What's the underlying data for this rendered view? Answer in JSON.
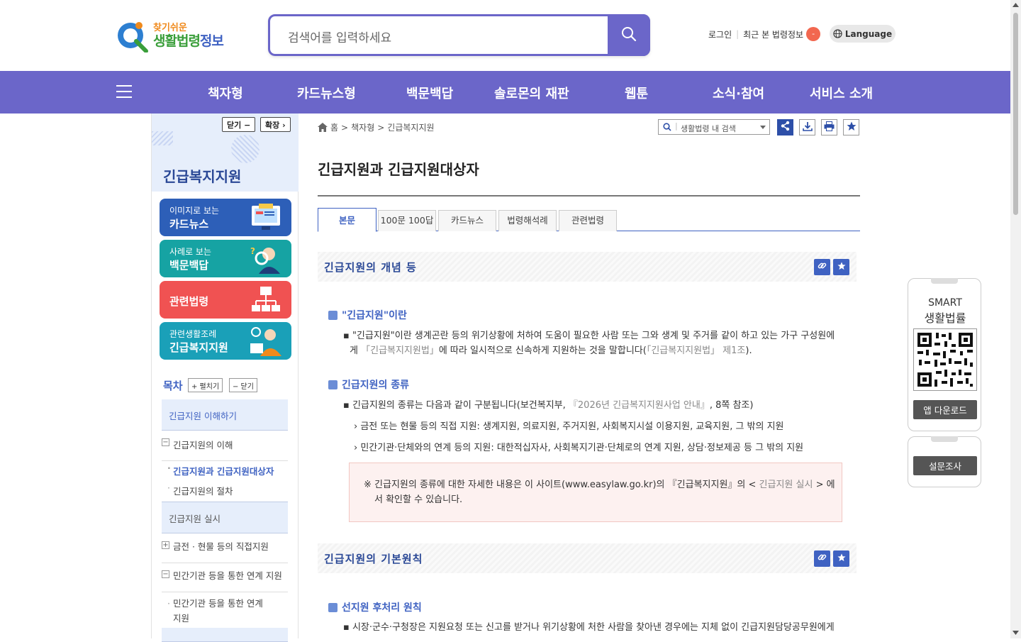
{
  "header": {
    "logo_top": "찾기쉬운",
    "logo_main": "생활법령",
    "logo_sub": "정보",
    "search_placeholder": "검색어를 입력하세요",
    "login": "로그인",
    "recent": "최근 본 법령정보",
    "recent_count": "-",
    "language": "Language"
  },
  "gnb": {
    "items": [
      "책자형",
      "카드뉴스형",
      "백문백답",
      "솔로몬의 재판",
      "웹툰",
      "소식·참여",
      "서비스 소개"
    ]
  },
  "sidebar": {
    "close_label": "닫기 −",
    "expand_label": "확장 ›",
    "title": "긴급복지지원",
    "cards": [
      {
        "small": "이미지로 보는",
        "big": "카드뉴스",
        "color": "#2d5fb8"
      },
      {
        "small": "사례로 보는",
        "big": "백문백답",
        "color": "#16a3a3"
      },
      {
        "small": "",
        "big": "관련법령",
        "color": "#f05252"
      },
      {
        "small": "관련생활조례",
        "big": "긴급복지지원",
        "color": "#1aa0b8"
      }
    ],
    "toc_head": "목차",
    "toc_open": "+ 펼치기",
    "toc_close": "− 닫기",
    "toc": [
      "긴급지원 이해하기",
      "긴급지원의 이해",
      "긴급지원과 긴급지원대상자",
      "긴급지원의 절차",
      "긴급지원 실시",
      "금전 · 현물 등의 직접지원",
      "민간기관 등을 통한 연계 지원",
      "민간기관 등을 통한 연계 지원"
    ]
  },
  "content": {
    "breadcrumb": [
      "홈",
      "책자형",
      "긴급복지지원"
    ],
    "site_search": "생활법령 내 검색",
    "title": "긴급지원과 긴급지원대상자",
    "tabs": [
      "본문",
      "100문 100답",
      "카드뉴스",
      "법령해석례",
      "관련법령"
    ],
    "sec1": "긴급지원의 개념 등",
    "h_a": "\"긴급지원\"이란",
    "p_a1": "\"긴급지원\"이란 생계곤란 등의 위기상황에 처하여 도움이 필요한 사람 또는 그와 생계 및 주거를 같이 하고 있는 가구 구성원에",
    "p_a2_pre": "게 ",
    "p_a2_link": "「긴급복지지원법」",
    "p_a2_mid": "에 따라 일시적으로 신속하게 지원하는 것을 말합니다(",
    "p_a2_link2": "「긴급복지지원법」 제1조",
    "p_a2_end": ").",
    "h_b": "긴급지원의 종류",
    "p_b1_pre": "긴급지원의 종류는 다음과 같이 구분됩니다(보건복지부, ",
    "p_b1_link": "『2026년 긴급복지지원사업 안내』",
    "p_b1_end": ", 8쪽 참조)",
    "p_b2": "금전 또는 현물 등의 직접 지원: 생계지원, 의료지원, 주거지원, 사회복지시설 이용지원, 교육지원, 그 밖의 지원",
    "p_b3": "민간기관·단체와의 연계 등의 지원: 대한적십자사, 사회복지기관·단체로의 연계 지원, 상담·정보제공 등 그 밖의 지원",
    "note1_pre": "※ 긴급지원의 종류에 대한 자세한 내용은 이 사이트(www.easylaw.go.kr)의 『긴급복지지원』의 < ",
    "note1_link": "긴급지원 실시",
    "note1_end": " > 에",
    "note2": "서 확인할 수 있습니다.",
    "sec2": "긴급지원의 기본원칙",
    "h_c": "선지원 후처리 원칙",
    "p_c1": "시장·군수·구청장은 지원요청 또는 신고를 받거나 위기상황에 처한 사람을 찾아낸 경우에는 지체 없이 긴급지원담당공무원에게"
  },
  "float": {
    "smart1": "SMART",
    "smart2": "생활법률",
    "app_btn": "앱 다운로드",
    "survey_btn": "설문조사"
  }
}
